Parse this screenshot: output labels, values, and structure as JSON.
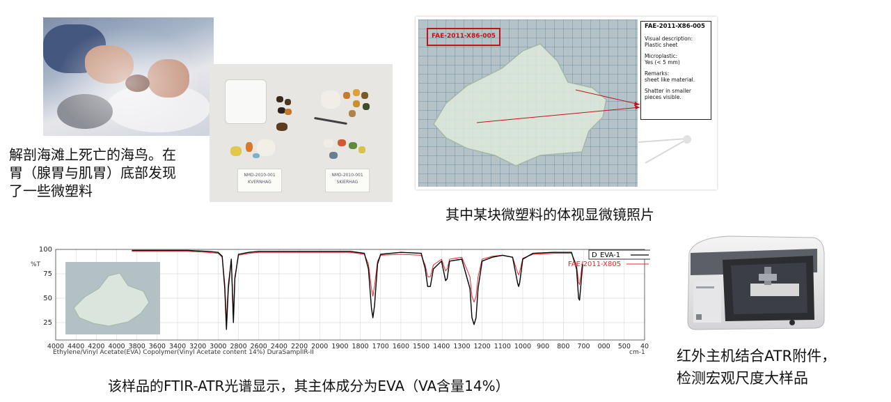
{
  "captions": {
    "dissection": [
      "解剖海滩上死亡的海鸟。在",
      "胃（腺胃与肌胃）底部发现",
      "了一些微塑料"
    ],
    "microscope": "其中某块微塑料的体视显微镜照片",
    "spectrum": "该样品的FTIR-ATR光谱显示，其主体成分为EVA（VA含量14%）",
    "instrument": [
      "红外主机结合ATR附件，",
      "检测宏观尺度大样品"
    ]
  },
  "sample_cards": {
    "left": [
      "NMD-2010-001",
      "KVERNHAG"
    ],
    "right": [
      "NMD-2010-001",
      "SKIERHAG"
    ]
  },
  "micro": {
    "sample_label": "FAE-2011-X86-005",
    "desc_title": "FAE-2011-X86-005",
    "desc_lines": [
      [
        "Visual description:",
        "Plastic sheet"
      ],
      [
        "Microplastic:",
        "Yes (< 5 mm)"
      ],
      [
        "Remarks:",
        "sheet like material."
      ],
      [
        "Shatter in smaller",
        "pieces visible."
      ]
    ]
  },
  "colors": {
    "reference_line": "#000000",
    "sample_line": "#e8242c",
    "label_red": "#c1121a"
  },
  "chart_data": {
    "type": "line",
    "xlabel": "cm-1",
    "ylabel": "%T",
    "xlim": [
      4000,
      400
    ],
    "ylim": [
      0,
      100
    ],
    "xticks": [
      4000,
      4400,
      4200,
      4000,
      3800,
      3600,
      3400,
      3200,
      3000,
      2800,
      2600,
      2400,
      2200,
      2000,
      1900,
      1800,
      1700,
      1600,
      1500,
      1400,
      1300,
      1200,
      1100,
      1000,
      900,
      800,
      700,
      600,
      500,
      400
    ],
    "xtick_labels": [
      "4000",
      "4400",
      "4200",
      "4000",
      "3800",
      "3600",
      "3400",
      "3200",
      "3000",
      "2800",
      "2600",
      "2400",
      "2200",
      "2000",
      "1900",
      "1800",
      "1700",
      "1600",
      "1500",
      "1400",
      "1300",
      "1200",
      "1100",
      "1000",
      "900",
      "800",
      "700",
      "000",
      "500",
      "40"
    ],
    "yticks": [
      100,
      75,
      50,
      25
    ],
    "ytick_labels": [
      "100",
      "75",
      "50",
      "25"
    ],
    "footer_text": "Ethylene/Vinyl Acetate(EVA) Copolymer(Vinyl Acetate content 14%)  DuraSamplIR-II",
    "xunit_text": "cm-1",
    "legend": [
      {
        "marker": "D",
        "name": "EVA-1",
        "color": "#000000"
      },
      {
        "marker": "",
        "name": "FAE-2011-X805",
        "color": "#e8242c"
      }
    ],
    "series": [
      {
        "name": "EVA-1",
        "color": "#000000",
        "x": [
          3850,
          3600,
          3300,
          3100,
          3000,
          2960,
          2935,
          2918,
          2900,
          2870,
          2850,
          2835,
          2800,
          2700,
          2600,
          2400,
          2200,
          2000,
          1850,
          1780,
          1760,
          1745,
          1738,
          1730,
          1715,
          1700,
          1600,
          1500,
          1480,
          1468,
          1455,
          1440,
          1400,
          1380,
          1372,
          1360,
          1300,
          1260,
          1250,
          1240,
          1230,
          1220,
          1200,
          1150,
          1100,
          1050,
          1025,
          1020,
          1015,
          1000,
          950,
          850,
          760,
          735,
          725,
          720,
          715,
          705
        ],
        "y": [
          99,
          99,
          99,
          98,
          97,
          93,
          60,
          18,
          60,
          90,
          25,
          70,
          95,
          97,
          98,
          98,
          98,
          98,
          98,
          96,
          80,
          40,
          30,
          42,
          85,
          95,
          97,
          96,
          80,
          62,
          62,
          80,
          88,
          68,
          70,
          88,
          90,
          60,
          30,
          23,
          30,
          60,
          88,
          92,
          94,
          92,
          65,
          62,
          66,
          90,
          96,
          97,
          97,
          80,
          50,
          48,
          60,
          85
        ]
      },
      {
        "name": "FAE-2011-X805",
        "color": "#e8242c",
        "x": [
          3850,
          3600,
          3300,
          3100,
          3000,
          2960,
          2935,
          2918,
          2900,
          2870,
          2850,
          2835,
          2800,
          2700,
          2600,
          2400,
          2200,
          2000,
          1850,
          1780,
          1760,
          1745,
          1738,
          1730,
          1715,
          1700,
          1600,
          1500,
          1480,
          1468,
          1455,
          1440,
          1400,
          1380,
          1372,
          1360,
          1300,
          1260,
          1250,
          1240,
          1230,
          1220,
          1200,
          1150,
          1100,
          1050,
          1025,
          1020,
          1015,
          1000,
          950,
          850,
          760,
          735,
          725,
          720,
          715,
          705
        ],
        "y": [
          98,
          98,
          98,
          97,
          96,
          92,
          65,
          28,
          65,
          90,
          35,
          72,
          94,
          96,
          97,
          97,
          97,
          97,
          97,
          95,
          85,
          60,
          52,
          62,
          88,
          94,
          95,
          94,
          84,
          72,
          72,
          84,
          90,
          78,
          80,
          90,
          92,
          72,
          52,
          46,
          52,
          72,
          90,
          93,
          94,
          92,
          76,
          74,
          77,
          91,
          95,
          96,
          96,
          84,
          66,
          64,
          72,
          88
        ]
      }
    ],
    "grid": true,
    "legend_placement": "top-right"
  }
}
